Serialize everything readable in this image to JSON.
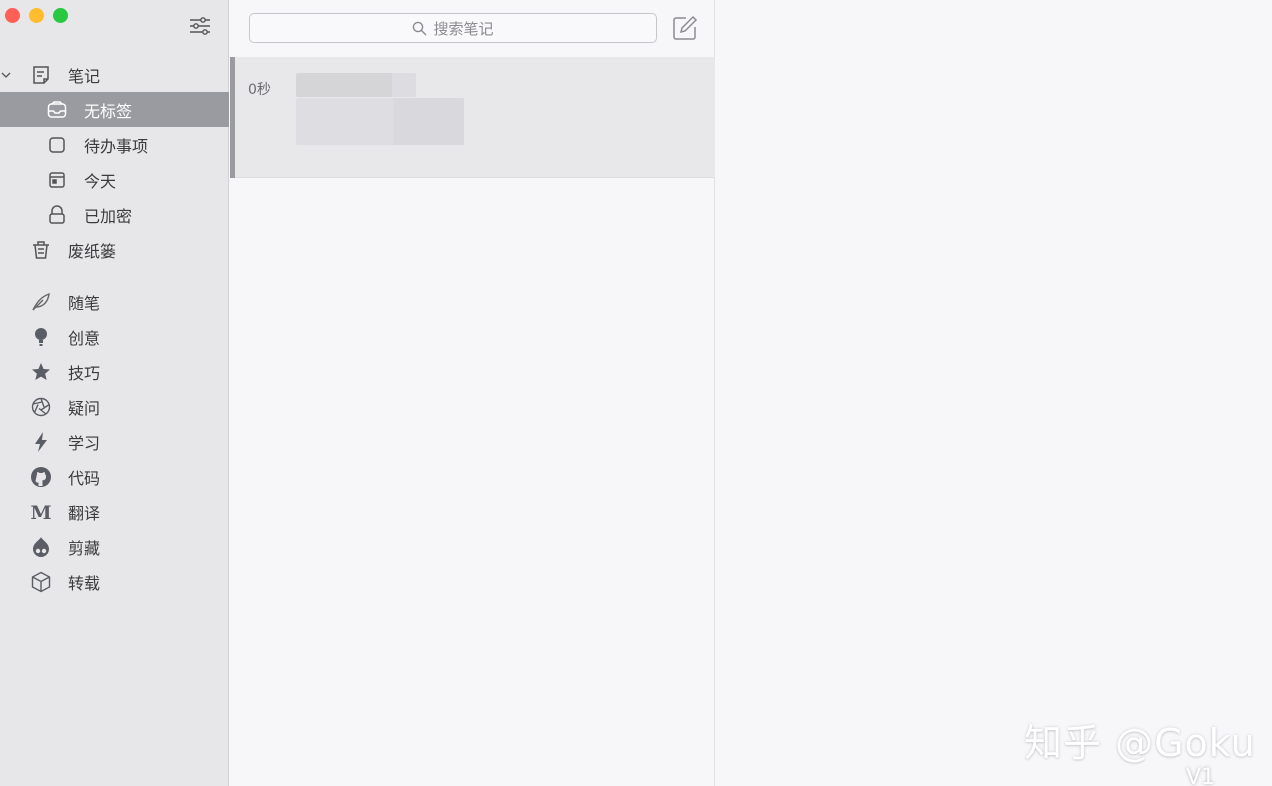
{
  "sidebar": {
    "notes_label": "笔记",
    "sub_items": [
      {
        "label": "无标签",
        "icon": "inbox-icon",
        "selected": true
      },
      {
        "label": "待办事项",
        "icon": "checkbox-icon"
      },
      {
        "label": "今天",
        "icon": "calendar-icon"
      },
      {
        "label": "已加密",
        "icon": "lock-icon"
      }
    ],
    "trash_label": "废纸篓",
    "tags": [
      {
        "label": "随笔",
        "icon": "feather-icon"
      },
      {
        "label": "创意",
        "icon": "lightbulb-icon"
      },
      {
        "label": "技巧",
        "icon": "star-icon"
      },
      {
        "label": "疑问",
        "icon": "aperture-icon"
      },
      {
        "label": "学习",
        "icon": "lightning-icon"
      },
      {
        "label": "代码",
        "icon": "github-icon"
      },
      {
        "label": "翻译",
        "icon": "medium-icon"
      },
      {
        "label": "剪藏",
        "icon": "drupal-icon"
      },
      {
        "label": "转载",
        "icon": "cube-icon"
      }
    ]
  },
  "search": {
    "placeholder": "搜索笔记"
  },
  "note_list": [
    {
      "time": "0秒"
    }
  ],
  "watermark": {
    "text": "知乎 @Goku",
    "sub": "V1"
  },
  "colors": {
    "selected": "#9a9ba1",
    "sidebar_bg": "#e7e6e8",
    "list_bg": "#f7f6f9"
  }
}
